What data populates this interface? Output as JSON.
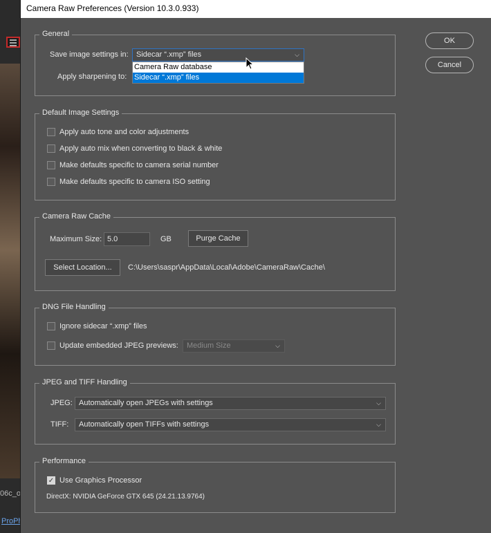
{
  "background_app": {
    "filename_fragment": "06c_o",
    "link_fragment": "ProPh"
  },
  "dialog": {
    "title": "Camera Raw Preferences  (Version 10.3.0.933)",
    "ok_label": "OK",
    "cancel_label": "Cancel"
  },
  "general": {
    "title": "General",
    "save_label": "Save image settings in:",
    "save_value": "Sidecar “.xmp” files",
    "sharpen_label": "Apply sharpening to:",
    "dropdown_options": [
      "Camera Raw database",
      "Sidecar “.xmp” files"
    ],
    "dropdown_selected_index": 1
  },
  "default_image": {
    "title": "Default Image Settings",
    "options": [
      {
        "label": "Apply auto tone and color adjustments",
        "checked": false
      },
      {
        "label": "Apply auto mix when converting to black & white",
        "checked": false
      },
      {
        "label": "Make defaults specific to camera serial number",
        "checked": false
      },
      {
        "label": "Make defaults specific to camera ISO setting",
        "checked": false
      }
    ]
  },
  "cache": {
    "title": "Camera Raw Cache",
    "max_size_label": "Maximum Size:",
    "max_size_value": "5.0",
    "unit": "GB",
    "purge_label": "Purge Cache",
    "select_location_label": "Select Location...",
    "path": "C:\\Users\\saspr\\AppData\\Local\\Adobe\\CameraRaw\\Cache\\"
  },
  "dng": {
    "title": "DNG File Handling",
    "ignore_label": "Ignore sidecar “.xmp” files",
    "update_label": "Update embedded JPEG previews:",
    "preview_size": "Medium Size"
  },
  "jpeg_tiff": {
    "title": "JPEG and TIFF Handling",
    "jpeg_label": "JPEG:",
    "jpeg_value": "Automatically open JPEGs with settings",
    "tiff_label": "TIFF:",
    "tiff_value": "Automatically open TIFFs with settings"
  },
  "performance": {
    "title": "Performance",
    "gpu_label": "Use Graphics Processor",
    "gpu_checked": true,
    "directx_info": "DirectX: NVIDIA GeForce GTX 645 (24.21.13.9764)"
  },
  "colors": {
    "dialog_bg": "#535353",
    "selection": "#0078d7",
    "title_bar": "#ffffff"
  }
}
